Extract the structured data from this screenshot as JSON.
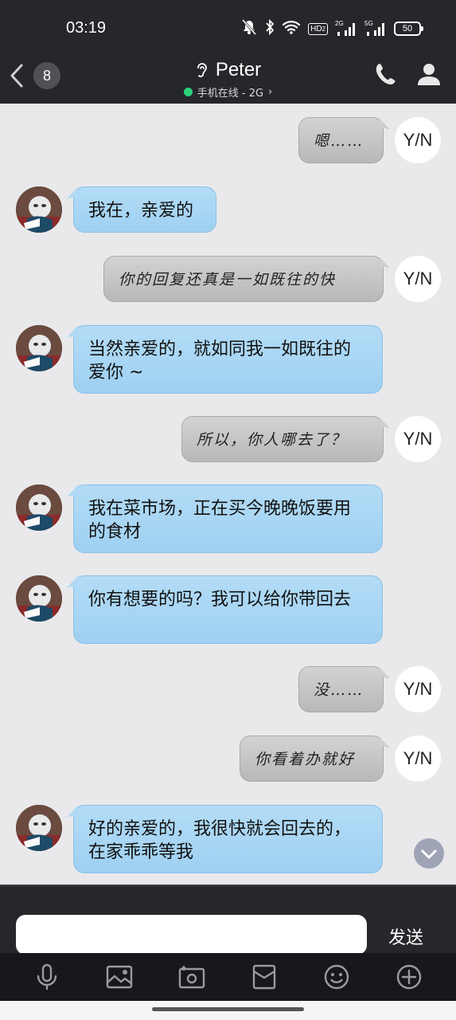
{
  "status_bar": {
    "time": "03:19",
    "hd_label": "HD",
    "hd_sub": "2",
    "net_2g": "2G",
    "net_5g": "5G",
    "battery": "50"
  },
  "header": {
    "unread_count": "8",
    "contact_name": "Peter",
    "presence": "手机在线 - 2G",
    "presence_chevron": "›"
  },
  "avatars": {
    "self_label": "Y/N"
  },
  "messages": [
    {
      "side": "out",
      "text": "嗯……"
    },
    {
      "side": "in",
      "text": "我在，亲爱的"
    },
    {
      "side": "out",
      "text": "你的回复还真是一如既往的快"
    },
    {
      "side": "in",
      "text": "当然亲爱的，就如同我一如既往的爱你 ~"
    },
    {
      "side": "out",
      "text": "所以，你人哪去了？"
    },
    {
      "side": "in",
      "text": "我在菜市场，正在买今晚晚饭要用的食材"
    },
    {
      "side": "in",
      "text": "你有想要的吗？我可以给你带回去"
    },
    {
      "side": "out",
      "text": "没……"
    },
    {
      "side": "out",
      "text": "你看着办就好"
    },
    {
      "side": "in",
      "text": "好的亲爱的，我很快就会回去的，在家乖乖等我"
    }
  ],
  "composer": {
    "input_value": "",
    "send_label": "发送"
  },
  "toolbar": {
    "icons": [
      "microphone-icon",
      "image-icon",
      "camera-icon",
      "red-packet-icon",
      "emoji-icon",
      "plus-icon"
    ]
  },
  "colors": {
    "bar_bg": "#26272b",
    "chat_bg": "#e9e9eb",
    "in_bubble": "#a9d6f4",
    "out_bubble": "#c4c4c4",
    "online": "#2ad37a"
  }
}
